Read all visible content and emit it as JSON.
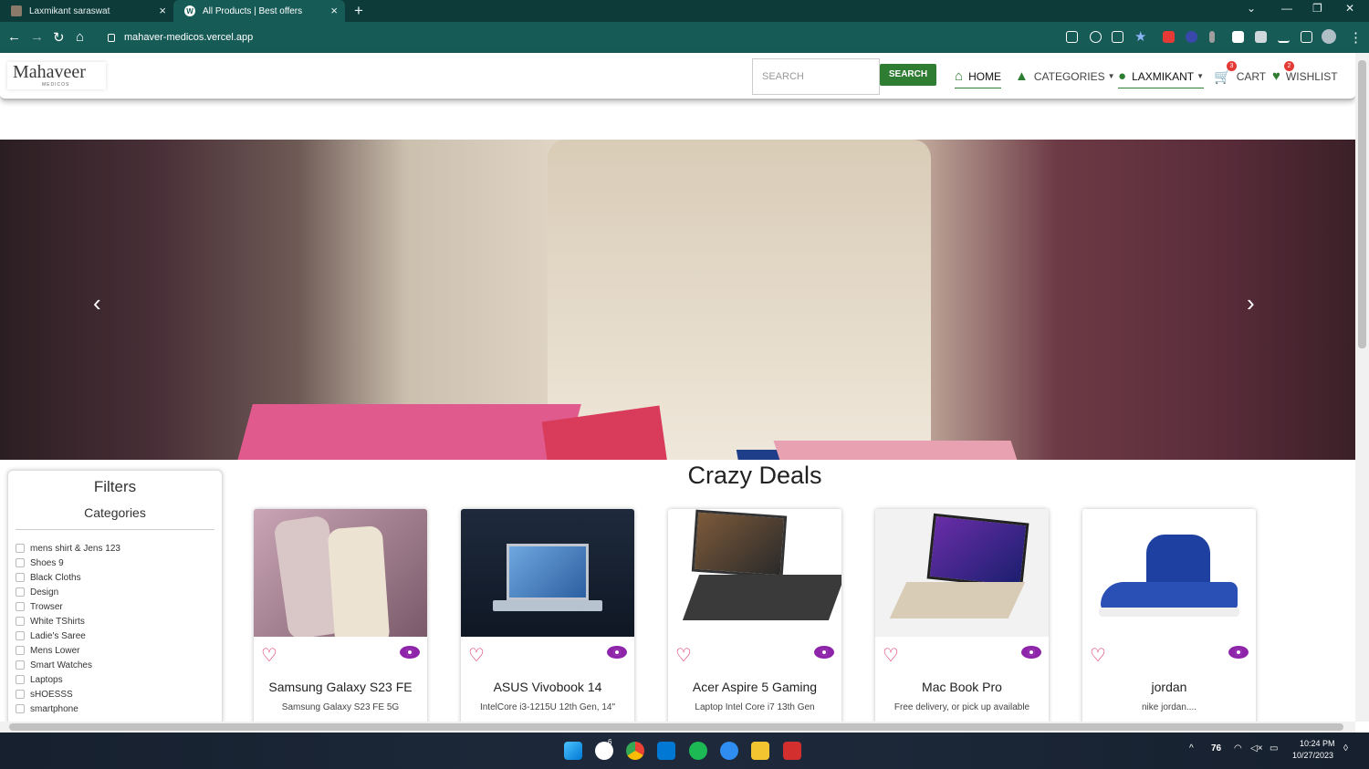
{
  "browser": {
    "tabs": [
      {
        "title": "Laxmikant saraswat",
        "active": false
      },
      {
        "title": "All Products | Best offers",
        "active": true
      }
    ],
    "url": "mahaver-medicos.vercel.app",
    "new_tab_icon": "plus-icon"
  },
  "site": {
    "logo_text": "Mahaveer",
    "logo_sub": "MEDICOS",
    "search_placeholder": "SEARCH",
    "search_button": "SEARCH",
    "nav": {
      "home": "HOME",
      "categories": "CATEGORIES",
      "user": "LAXMIKANT",
      "cart": "CART",
      "cart_count": "3",
      "wishlist": "WISHLIST",
      "wishlist_count": "2"
    }
  },
  "filters": {
    "title": "Filters",
    "subtitle": "Categories",
    "categories": [
      "mens shirt & Jens 123",
      "Shoes 9",
      "Black Cloths",
      "Design",
      "Trowser",
      "White TShirts",
      "Ladie's Saree",
      "Mens Lower",
      "Smart Watches",
      "Laptops",
      "sHOESSS",
      "smartphone"
    ]
  },
  "deals": {
    "title": "Crazy Deals",
    "products": [
      {
        "name": "Samsung Galaxy S23 FE",
        "desc": "Samsung Galaxy S23 FE 5G"
      },
      {
        "name": "ASUS Vivobook 14",
        "desc": "IntelCore i3-1215U 12th Gen, 14\""
      },
      {
        "name": "Acer Aspire 5 Gaming",
        "desc": "Laptop Intel Core i7 13th Gen"
      },
      {
        "name": "Mac Book Pro",
        "desc": "Free delivery, or pick up available"
      },
      {
        "name": "jordan",
        "desc": "nike jordan...."
      }
    ]
  },
  "taskbar": {
    "temperature": "76",
    "time": "10:24 PM",
    "date": "10/27/2023",
    "whatsapp_badge": "6"
  },
  "colors": {
    "chrome_dark": "#0c3b3a",
    "chrome_toolbar": "#175b57",
    "accent_green": "#2e7d32",
    "heart": "#d81b60",
    "eye": "#8e24aa"
  }
}
